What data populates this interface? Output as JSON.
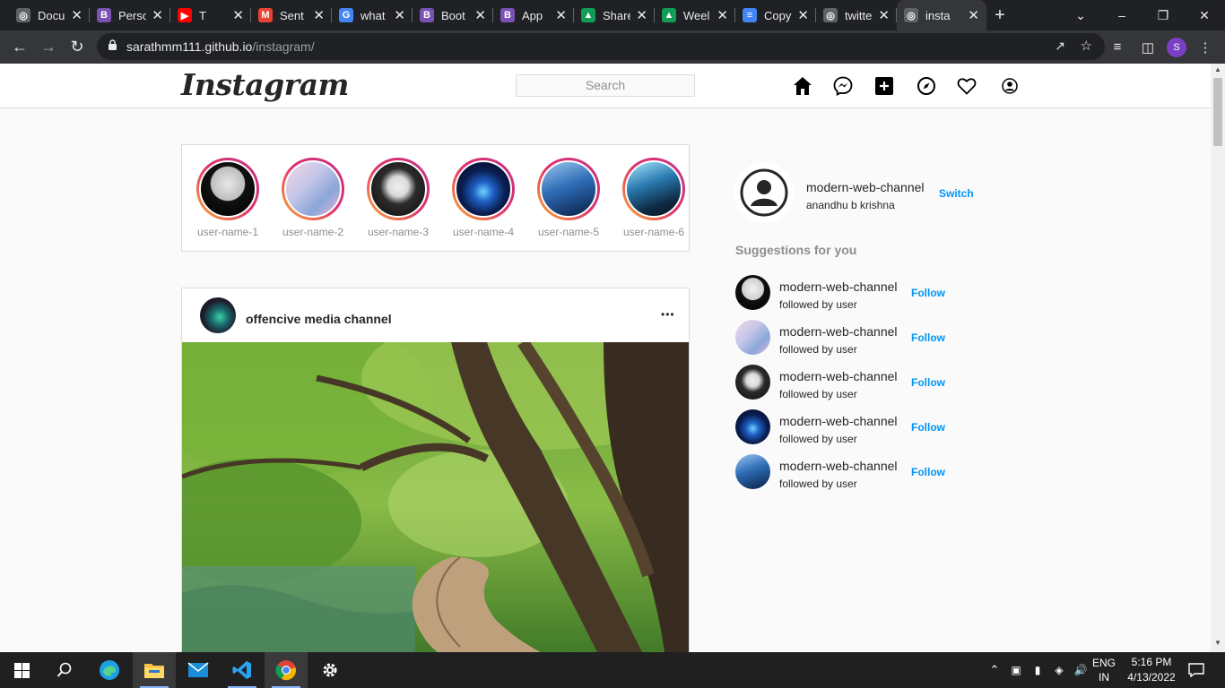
{
  "browser": {
    "tabs": [
      {
        "label": "Docu",
        "icon": "globe-icon",
        "color": "#5f6368"
      },
      {
        "label": "Perso",
        "icon": "bootstrap-icon",
        "color": "#7952b3"
      },
      {
        "label": "T",
        "icon": "youtube-icon",
        "color": "#ff0000"
      },
      {
        "label": "Sent",
        "icon": "gmail-icon",
        "color": "#ea4335"
      },
      {
        "label": "what",
        "icon": "google-icon",
        "color": "#4285f4"
      },
      {
        "label": "Boot",
        "icon": "bootstrap-icon",
        "color": "#7952b3"
      },
      {
        "label": "App",
        "icon": "bootstrap-icon",
        "color": "#7952b3"
      },
      {
        "label": "Share",
        "icon": "drive-icon",
        "color": "#0f9d58"
      },
      {
        "label": "Weel",
        "icon": "drive-icon",
        "color": "#0f9d58"
      },
      {
        "label": "Copy",
        "icon": "docs-icon",
        "color": "#4285f4"
      },
      {
        "label": "twitte",
        "icon": "globe-icon",
        "color": "#5f6368"
      },
      {
        "label": "insta",
        "icon": "globe-icon",
        "color": "#5f6368"
      }
    ],
    "url_host": "sarathmm111.github.io",
    "url_path": "/instagram/",
    "profile_initial": "S"
  },
  "instagram": {
    "logo": "Instagram",
    "search_placeholder": "Search",
    "stories": [
      {
        "name": "user-name-1",
        "bg": "radial-gradient(circle at 50% 40%, #e8e8e8 0%, #bdbdbd 40%, #111 42%, #000 100%)"
      },
      {
        "name": "user-name-2",
        "bg": "linear-gradient(135deg, #f3d6e8 0%, #c5c6e8 40%, #8aa6d8 70%, #e9b7d9 100%)"
      },
      {
        "name": "user-name-3",
        "bg": "radial-gradient(circle at 50% 45%, #f0f0f0 0%, #d9d9d9 25%, #2b2b2b 45%, #0e0e0e 100%)"
      },
      {
        "name": "user-name-4",
        "bg": "radial-gradient(circle at 50% 55%, #6fd3ff 0%, #1e5fc4 25%, #0a1d4f 55%, #04081c 100%)"
      },
      {
        "name": "user-name-5",
        "bg": "linear-gradient(160deg, #9ec8f0 0%, #2e6db6 45%, #163a6e 80%, #0b1e3c 100%)"
      },
      {
        "name": "user-name-6",
        "bg": "linear-gradient(160deg, #a8e6ff 0%, #2a7ab0 40%, #0e2a44 75%, #05121f 100%)"
      }
    ],
    "post": {
      "username": "offencive media channel",
      "more": "•••"
    },
    "side_profile": {
      "name": "modern-web-channel",
      "sub": "anandhu b krishna",
      "action": "Switch"
    },
    "suggestions_title": "Suggestions for you",
    "suggestions": [
      {
        "name": "modern-web-channel",
        "sub": "followed by user",
        "action": "Follow",
        "bg": "radial-gradient(circle at 50% 40%, #f2f2f2 0%, #cfcfcf 40%, #111 42%, #000 100%)"
      },
      {
        "name": "modern-web-channel",
        "sub": "followed by user",
        "action": "Follow",
        "bg": "linear-gradient(135deg, #f3d6e8 0%, #c5c6e8 40%, #8aa6d8 70%, #e9b7d9 100%)"
      },
      {
        "name": "modern-web-channel",
        "sub": "followed by user",
        "action": "Follow",
        "bg": "radial-gradient(circle at 50% 45%, #f0f0f0 0%, #d9d9d9 25%, #2b2b2b 45%, #0e0e0e 100%)"
      },
      {
        "name": "modern-web-channel",
        "sub": "followed by user",
        "action": "Follow",
        "bg": "radial-gradient(circle at 50% 55%, #6fd3ff 0%, #1e5fc4 25%, #0a1d4f 55%, #04081c 100%)"
      },
      {
        "name": "modern-web-channel",
        "sub": "followed by user",
        "action": "Follow",
        "bg": "linear-gradient(160deg, #9ec8f0 0%, #2e6db6 45%, #163a6e 80%, #0b1e3c 100%)"
      }
    ]
  },
  "taskbar": {
    "lang_top": "ENG",
    "lang_bottom": "IN",
    "time": "5:16 PM",
    "date": "4/13/2022"
  }
}
